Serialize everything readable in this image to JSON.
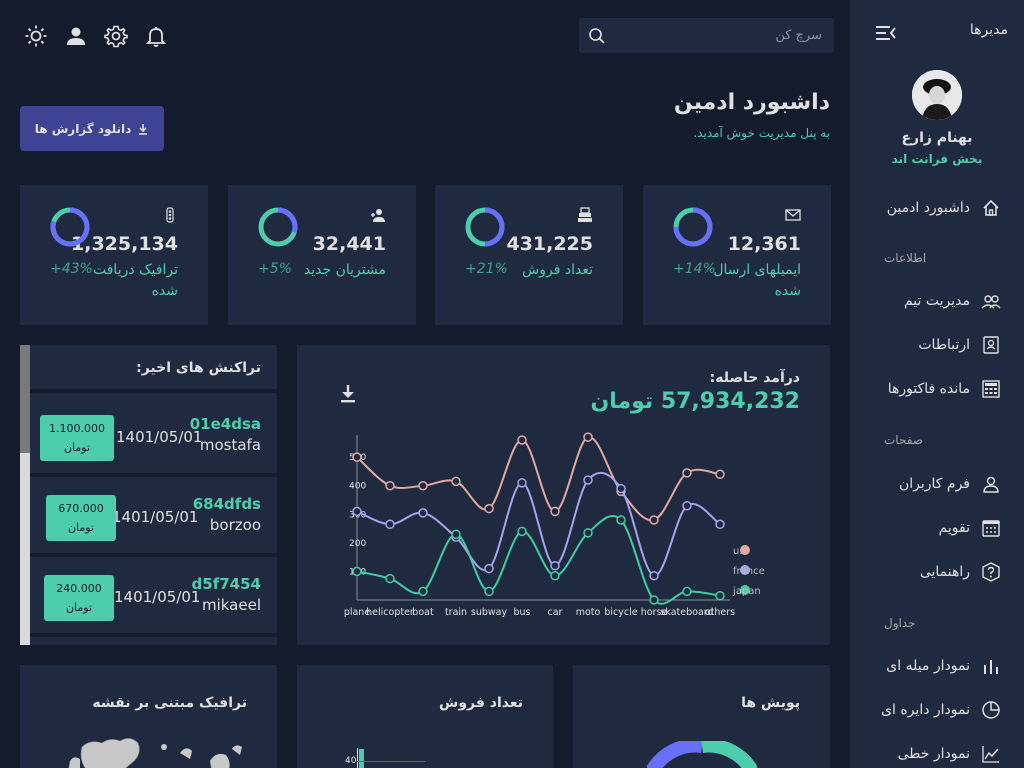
{
  "sidebar": {
    "brand": "مدیرها",
    "user_name": "بهنام زارع",
    "user_role": "بخش فرانت اند",
    "dashboard": "داشبورد ادمین",
    "sections": [
      "اطلاعات",
      "صفحات",
      "جداول"
    ],
    "items": [
      {
        "label": "مدیریت تیم",
        "icon": "team-icon"
      },
      {
        "label": "ارتباطات",
        "icon": "contacts-icon"
      },
      {
        "label": "مانده فاکتورها",
        "icon": "invoices-icon"
      },
      {
        "label": "فرم کاربران",
        "icon": "user-form-icon"
      },
      {
        "label": "تقویم",
        "icon": "calendar-icon"
      },
      {
        "label": "راهنمایی",
        "icon": "help-icon"
      },
      {
        "label": "نمودار میله ای",
        "icon": "bar-chart-icon"
      },
      {
        "label": "نمودار دایره ای",
        "icon": "pie-chart-icon"
      },
      {
        "label": "نمودار خطی",
        "icon": "line-chart-icon"
      }
    ]
  },
  "topbar": {
    "search_placeholder": "سرچ کن",
    "icons": [
      "sun-icon",
      "person-icon",
      "gear-icon",
      "bell-icon"
    ]
  },
  "header": {
    "title": "داشبورد ادمین",
    "subtitle": "به پنل مدیریت خوش آمدید.",
    "download_label": "دانلود گزارش ها"
  },
  "stats": [
    {
      "value": "12,361",
      "label": "ایمیلهای ارسال شده",
      "pct": "+14%",
      "progress": 0.75,
      "icon": "email-icon"
    },
    {
      "value": "431,225",
      "label": "تعداد فروش",
      "pct": "+21%",
      "progress": 0.5,
      "icon": "sales-icon"
    },
    {
      "value": "32,441",
      "label": "مشتریان جدید",
      "pct": "+5%",
      "progress": 0.3,
      "icon": "person-add-icon"
    },
    {
      "value": "1,325,134",
      "label": "ترافیک دریافت شده",
      "pct": "+43%",
      "progress": 0.8,
      "icon": "traffic-icon"
    }
  ],
  "revenue": {
    "title": "درآمد حاصله:",
    "value": "57,934,232 تومان"
  },
  "transactions": {
    "title": "تراکنش های اخیر:",
    "rows": [
      {
        "id": "01e4dsa",
        "user": "mostafa",
        "date": "1401/05/01",
        "amount": "1.100.000",
        "currency": "تومان"
      },
      {
        "id": "684dfds",
        "user": "borzoo",
        "date": "1401/05/01",
        "amount": "670.000",
        "currency": "تومان"
      },
      {
        "id": "d5f7454",
        "user": "mikaeel",
        "date": "1401/05/01",
        "amount": "240.000",
        "currency": "تومان"
      }
    ]
  },
  "bottom_cards": {
    "campaign": "پویش ها",
    "sales": "تعداد فروش",
    "geo": "ترافیک مبتنی بر نقشه",
    "sales_tick": "40"
  },
  "chart_data": {
    "type": "line",
    "categories": [
      "plane",
      "helicopter",
      "boat",
      "train",
      "subway",
      "bus",
      "car",
      "moto",
      "bicycle",
      "horse",
      "skateboard",
      "others"
    ],
    "yticks": [
      100,
      200,
      300,
      400,
      500
    ],
    "ylim": [
      0,
      560
    ],
    "legend_position": "right",
    "series": [
      {
        "name": "us",
        "color": "#e2a9a0",
        "values": [
          500,
          400,
          400,
          415,
          320,
          560,
          310,
          570,
          380,
          280,
          445,
          440
        ]
      },
      {
        "name": "france",
        "color": "#a4a3ee",
        "values": [
          310,
          265,
          305,
          220,
          110,
          410,
          120,
          420,
          390,
          85,
          330,
          265
        ]
      },
      {
        "name": "japan",
        "color": "#3dcf9f",
        "values": [
          100,
          75,
          30,
          230,
          30,
          240,
          85,
          235,
          280,
          0,
          30,
          15
        ]
      }
    ]
  }
}
